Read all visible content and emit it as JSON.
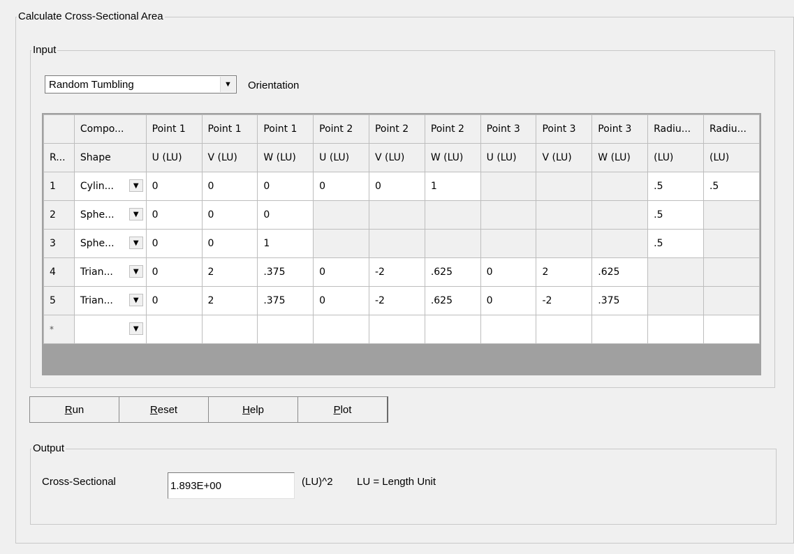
{
  "outer_title": "Calculate Cross-Sectional Area",
  "input_title": "Input",
  "orientation": {
    "value": "Random Tumbling",
    "label": "Orientation"
  },
  "grid": {
    "header1": [
      "",
      "Compo...",
      "Point 1",
      "Point 1",
      "Point 1",
      "Point 2",
      "Point 2",
      "Point 2",
      "Point 3",
      "Point 3",
      "Point 3",
      "Radiu...",
      "Radiu..."
    ],
    "header2": [
      "R...",
      "Shape",
      "U (LU)",
      "V (LU)",
      "W (LU)",
      "U (LU)",
      "V (LU)",
      "W (LU)",
      "U (LU)",
      "V (LU)",
      "W (LU)",
      "(LU)",
      "(LU)"
    ],
    "rows": [
      {
        "id": "1",
        "shape": "Cylin...",
        "values": [
          "0",
          "0",
          "0",
          "0",
          "0",
          "1",
          "",
          "",
          "",
          ".5",
          ".5"
        ]
      },
      {
        "id": "2",
        "shape": "Sphe...",
        "values": [
          "0",
          "0",
          "0",
          "",
          "",
          "",
          "",
          "",
          "",
          ".5",
          ""
        ]
      },
      {
        "id": "3",
        "shape": "Sphe...",
        "values": [
          "0",
          "0",
          "1",
          "",
          "",
          "",
          "",
          "",
          "",
          ".5",
          ""
        ]
      },
      {
        "id": "4",
        "shape": "Trian...",
        "values": [
          "0",
          "2",
          ".375",
          "0",
          "-2",
          ".625",
          "0",
          "2",
          ".625",
          "",
          ""
        ]
      },
      {
        "id": "5",
        "shape": "Trian...",
        "values": [
          "0",
          "2",
          ".375",
          "0",
          "-2",
          ".625",
          "0",
          "-2",
          ".375",
          "",
          ""
        ]
      }
    ],
    "new_row_marker": "*"
  },
  "buttons": {
    "run": {
      "mnemonic": "R",
      "rest": "un"
    },
    "reset": {
      "mnemonic": "R",
      "rest": "eset"
    },
    "help": {
      "mnemonic": "H",
      "rest": "elp"
    },
    "plot": {
      "mnemonic": "P",
      "rest": "lot"
    }
  },
  "output_title": "Output",
  "output": {
    "label": "Cross-Sectional",
    "value": "1.893E+00",
    "unit": "(LU)^2",
    "note": "LU = Length Unit"
  }
}
